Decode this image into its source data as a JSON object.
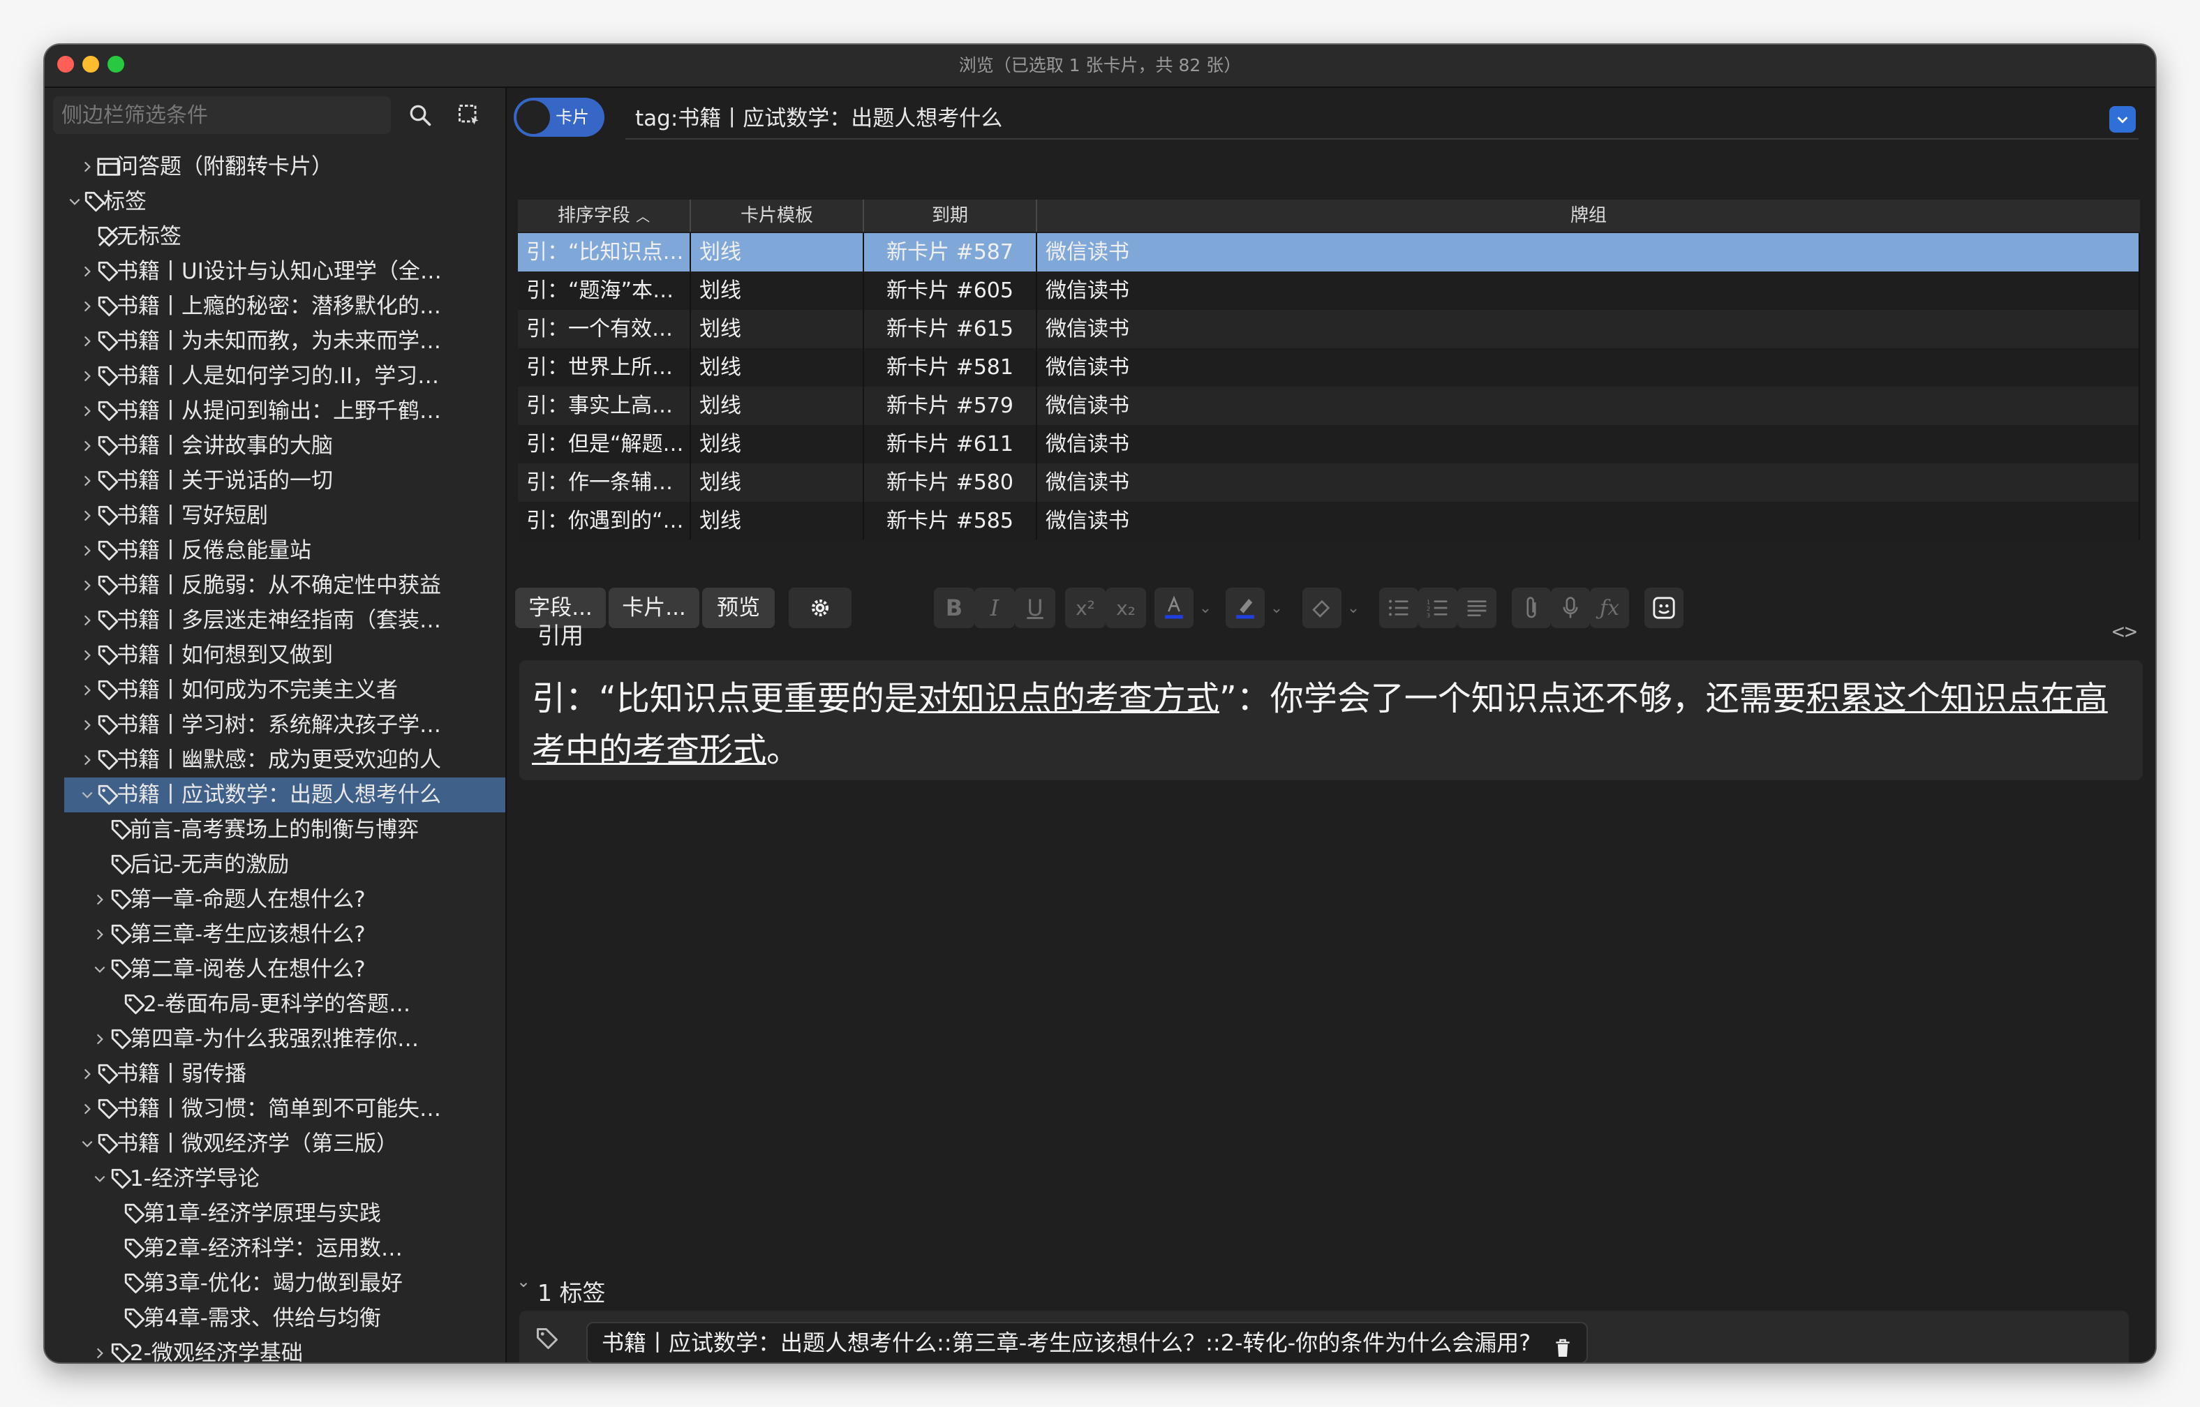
{
  "window": {
    "title": "浏览（已选取 1 张卡片，共 82 张）"
  },
  "sidebar": {
    "filter_placeholder": "侧边栏筛选条件",
    "tree": [
      {
        "label": "问答题（附翻转卡片）",
        "depth": 1,
        "chevron": "right",
        "icon": "card-type-icon"
      },
      {
        "label": "标签",
        "depth": 0,
        "chevron": "down",
        "icon": "tag-icon"
      },
      {
        "label": "无标签",
        "depth": 1,
        "chevron": "none",
        "icon": "untagged-icon"
      },
      {
        "label": "书籍丨UI设计与认知心理学（全…",
        "depth": 1,
        "chevron": "right",
        "icon": "tag-icon"
      },
      {
        "label": "书籍丨上瘾的秘密：潜移默化的…",
        "depth": 1,
        "chevron": "right",
        "icon": "tag-icon"
      },
      {
        "label": "书籍丨为未知而教，为未来而学…",
        "depth": 1,
        "chevron": "right",
        "icon": "tag-icon"
      },
      {
        "label": "书籍丨人是如何学习的.II，学习…",
        "depth": 1,
        "chevron": "right",
        "icon": "tag-icon"
      },
      {
        "label": "书籍丨从提问到输出：上野千鹤…",
        "depth": 1,
        "chevron": "right",
        "icon": "tag-icon"
      },
      {
        "label": "书籍丨会讲故事的大脑",
        "depth": 1,
        "chevron": "right",
        "icon": "tag-icon"
      },
      {
        "label": "书籍丨关于说话的一切",
        "depth": 1,
        "chevron": "right",
        "icon": "tag-icon"
      },
      {
        "label": "书籍丨写好短剧",
        "depth": 1,
        "chevron": "right",
        "icon": "tag-icon"
      },
      {
        "label": "书籍丨反倦怠能量站",
        "depth": 1,
        "chevron": "right",
        "icon": "tag-icon"
      },
      {
        "label": "书籍丨反脆弱：从不确定性中获益",
        "depth": 1,
        "chevron": "right",
        "icon": "tag-icon"
      },
      {
        "label": "书籍丨多层迷走神经指南（套装…",
        "depth": 1,
        "chevron": "right",
        "icon": "tag-icon"
      },
      {
        "label": "书籍丨如何想到又做到",
        "depth": 1,
        "chevron": "right",
        "icon": "tag-icon"
      },
      {
        "label": "书籍丨如何成为不完美主义者",
        "depth": 1,
        "chevron": "right",
        "icon": "tag-icon"
      },
      {
        "label": "书籍丨学习树：系统解决孩子学…",
        "depth": 1,
        "chevron": "right",
        "icon": "tag-icon"
      },
      {
        "label": "书籍丨幽默感：成为更受欢迎的人",
        "depth": 1,
        "chevron": "right",
        "icon": "tag-icon"
      },
      {
        "label": "书籍丨应试数学：出题人想考什么",
        "depth": 1,
        "chevron": "down",
        "icon": "tag-icon",
        "selected": true
      },
      {
        "label": "前言-高考赛场上的制衡与博弈",
        "depth": 2,
        "chevron": "none",
        "icon": "tag-icon"
      },
      {
        "label": "后记-无声的激励",
        "depth": 2,
        "chevron": "none",
        "icon": "tag-icon"
      },
      {
        "label": "第一章-命题人在想什么?",
        "depth": 2,
        "chevron": "right",
        "icon": "tag-icon"
      },
      {
        "label": "第三章-考生应该想什么?",
        "depth": 2,
        "chevron": "right",
        "icon": "tag-icon"
      },
      {
        "label": "第二章-阅卷人在想什么?",
        "depth": 2,
        "chevron": "down",
        "icon": "tag-icon"
      },
      {
        "label": "2-卷面布局-更科学的答题…",
        "depth": 3,
        "chevron": "none",
        "icon": "tag-icon"
      },
      {
        "label": "第四章-为什么我强烈推荐你…",
        "depth": 2,
        "chevron": "right",
        "icon": "tag-icon"
      },
      {
        "label": "书籍丨弱传播",
        "depth": 1,
        "chevron": "right",
        "icon": "tag-icon"
      },
      {
        "label": "书籍丨微习惯：简单到不可能失…",
        "depth": 1,
        "chevron": "right",
        "icon": "tag-icon"
      },
      {
        "label": "书籍丨微观经济学（第三版）",
        "depth": 1,
        "chevron": "down",
        "icon": "tag-icon"
      },
      {
        "label": "1-经济学导论",
        "depth": 2,
        "chevron": "down",
        "icon": "tag-icon"
      },
      {
        "label": "第1章-经济学原理与实践",
        "depth": 3,
        "chevron": "none",
        "icon": "tag-icon"
      },
      {
        "label": "第2章-经济科学：运用数…",
        "depth": 3,
        "chevron": "none",
        "icon": "tag-icon"
      },
      {
        "label": "第3章-优化：竭力做到最好",
        "depth": 3,
        "chevron": "none",
        "icon": "tag-icon"
      },
      {
        "label": "第4章-需求、供给与均衡",
        "depth": 3,
        "chevron": "none",
        "icon": "tag-icon"
      },
      {
        "label": "2-微观经济学基础",
        "depth": 2,
        "chevron": "right",
        "icon": "tag-icon"
      }
    ]
  },
  "search": {
    "toggle_label": "卡片",
    "query": "tag:书籍丨应试数学：出题人想考什么"
  },
  "table": {
    "columns": [
      "排序字段",
      "卡片模板",
      "到期",
      "牌组"
    ],
    "rows": [
      {
        "sort": "引：“比知识点…",
        "template": "划线",
        "due": "新卡片 #587",
        "deck": "微信读书",
        "selected": true
      },
      {
        "sort": "引：“题海”本…",
        "template": "划线",
        "due": "新卡片 #605",
        "deck": "微信读书"
      },
      {
        "sort": "引：一个有效…",
        "template": "划线",
        "due": "新卡片 #615",
        "deck": "微信读书"
      },
      {
        "sort": "引：世界上所…",
        "template": "划线",
        "due": "新卡片 #581",
        "deck": "微信读书"
      },
      {
        "sort": "引：事实上高…",
        "template": "划线",
        "due": "新卡片 #579",
        "deck": "微信读书"
      },
      {
        "sort": "引：但是“解题…",
        "template": "划线",
        "due": "新卡片 #611",
        "deck": "微信读书"
      },
      {
        "sort": "引：作一条辅…",
        "template": "划线",
        "due": "新卡片 #580",
        "deck": "微信读书"
      },
      {
        "sort": "引：你遇到的“…",
        "template": "划线",
        "due": "新卡片 #585",
        "deck": "微信读书"
      }
    ]
  },
  "toolbar": {
    "fields_label": "字段...",
    "cards_label": "卡片...",
    "preview_label": "预览"
  },
  "editor": {
    "field_name": "引用",
    "text_parts": [
      {
        "text": "引：“比知识点更重要的是",
        "u": false
      },
      {
        "text": "对知识点的考查方式",
        "u": true
      },
      {
        "text": "”：你学会了一个知识点还不够，还需要",
        "u": false
      },
      {
        "text": "积累这个知识点在高考中的考查形式",
        "u": true
      },
      {
        "text": "。",
        "u": false
      }
    ]
  },
  "tags": {
    "header": "1 标签",
    "items": [
      "书籍丨应试数学：出题人想考什么::第三章-考生应该想什么？::2-转化-你的条件为什么会漏用?"
    ]
  },
  "colors": {
    "accent": "#3667c6",
    "selection": "#7fa8d9",
    "sidebar_selection": "#3f6088",
    "color_a": "#1f3fe0"
  }
}
